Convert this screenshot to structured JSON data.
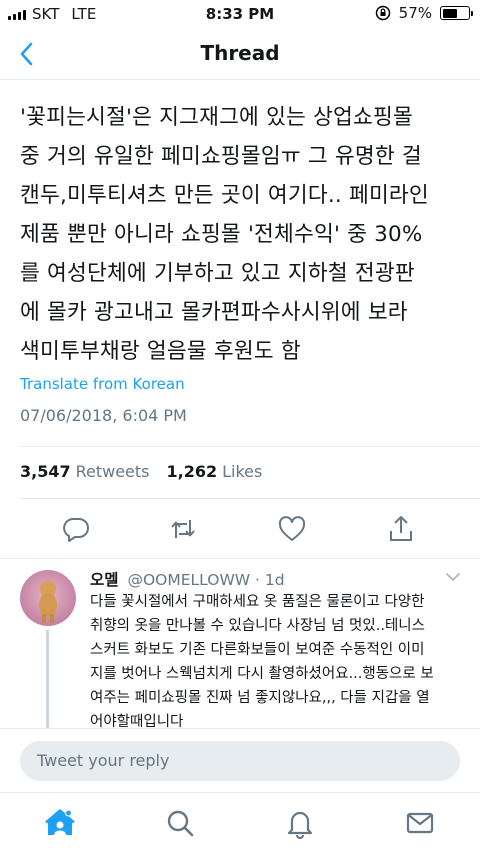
{
  "status_bar": {
    "carrier": "SKT",
    "network": "LTE",
    "time": "8:33 PM",
    "battery": "57%",
    "battery_level": 0.57
  },
  "nav": {
    "title": "Thread",
    "back_icon": "chevron-left-icon"
  },
  "tweet": {
    "lines": [
      "'꽃피는시절'은 지그재그에 있는 상업쇼핑몰",
      "중 거의 유일한 페미쇼핑몰임ㅠ 그 유명한 걸",
      "캔두,미투티셔츠 만든 곳이 여기다.. 페미라인",
      "제품 뿐만 아니라 쇼핑몰 '전체수익' 중 30%",
      "를 여성단체에 기부하고 있고 지하철 전광판",
      "에 몰카 광고내고 몰카편파수사시위에 보라",
      "색미투부채랑 얼음물 후원도 함"
    ],
    "translate": "Translate from Korean",
    "timestamp": "07/06/2018, 6:04 PM",
    "retweets_count": "3,547",
    "retweets_label": "Retweets",
    "likes_count": "1,262",
    "likes_label": "Likes",
    "actions": [
      "reply-icon",
      "retweet-icon",
      "heart-icon",
      "share-icon"
    ]
  },
  "reply": {
    "name": "오멜",
    "handle": "@OOMELLOWW · 1d",
    "lines": [
      "다들 꽃시절에서 구매하세요 옷 품질은 물론이고 다양한",
      "취향의 옷을 만나볼 수 있습니다 사장님 넘 멋있..테니스",
      "스커트 화보도 기존 다른화보들이 보여준 수동적인 이미",
      "지를 벗어나 스웩넘치게 다시 촬영하셨어요...행동으로 보",
      "여주는 페미쇼핑몰 진짜 넘 좋지않나요,,, 다들 지갑을 열",
      "어야할때입니다"
    ]
  },
  "composer": {
    "placeholder": "Tweet your reply"
  },
  "tab_bar": [
    "home-icon",
    "search-icon",
    "notifications-icon",
    "messages-icon"
  ],
  "colors": {
    "accent": "#1da1f2",
    "secondary_text": "#657786",
    "divider": "#e6ecf0"
  }
}
